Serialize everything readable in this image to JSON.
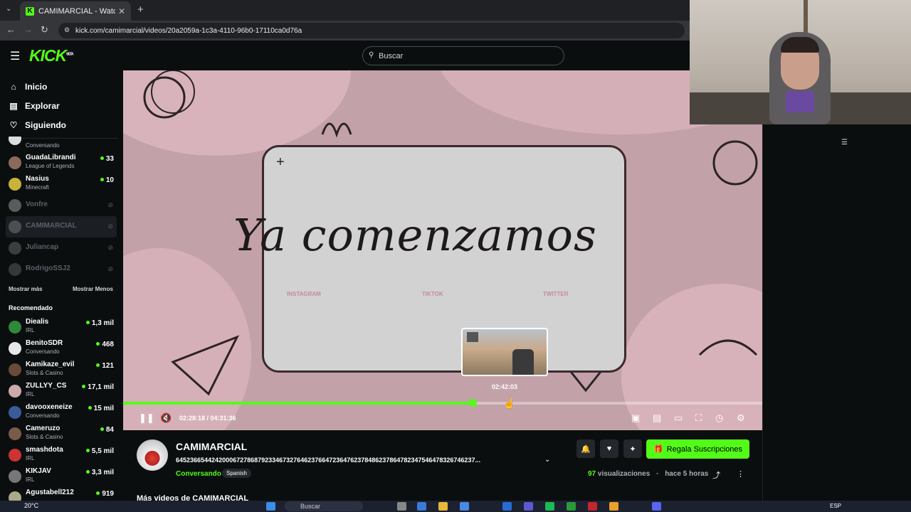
{
  "browser": {
    "tab_title": "CAMIMARCIAL - Watch the VO",
    "url": "kick.com/camimarcial/videos/20a2059a-1c3a-4110-96b0-17110ca0d76a"
  },
  "header": {
    "logo": "KICK",
    "logo_badge": "BETA",
    "search_placeholder": "Buscar"
  },
  "sidebar": {
    "nav": [
      {
        "label": "Inicio",
        "icon": "home-icon"
      },
      {
        "label": "Explorar",
        "icon": "compass-icon"
      },
      {
        "label": "Siguiendo",
        "icon": "heart-icon"
      }
    ],
    "following": [
      {
        "name": "",
        "category": "Conversando",
        "viewers": "",
        "state": "partial"
      },
      {
        "name": "GuadaLibrandi",
        "category": "League of Legends",
        "viewers": "33"
      },
      {
        "name": "Nasius",
        "category": "Minecraft",
        "viewers": "10"
      },
      {
        "name": "Vonfre",
        "category": "",
        "viewers": "",
        "state": "offline"
      },
      {
        "name": "CAMIMARCIAL",
        "category": "",
        "viewers": "",
        "state": "offline-selected"
      },
      {
        "name": "Juliancap",
        "category": "",
        "viewers": "",
        "state": "offline"
      },
      {
        "name": "RodrigoSSJ2",
        "category": "",
        "viewers": "",
        "state": "offline"
      }
    ],
    "show_more": "Mostrar más",
    "show_less": "Mostrar Menos",
    "recommended_title": "Recomendado",
    "recommended": [
      {
        "name": "Diealis",
        "category": "IRL",
        "viewers": "1,3 mil"
      },
      {
        "name": "BenitoSDR",
        "category": "Conversando",
        "viewers": "468"
      },
      {
        "name": "Kamikaze_evil",
        "category": "Slots & Casino",
        "viewers": "121"
      },
      {
        "name": "ZULLYY_CS",
        "category": "IRL",
        "viewers": "17,1 mil"
      },
      {
        "name": "davooxeneize",
        "category": "Conversando",
        "viewers": "15 mil"
      },
      {
        "name": "Cameruzo",
        "category": "Slots & Casino",
        "viewers": "84"
      },
      {
        "name": "smashdota",
        "category": "IRL",
        "viewers": "5,5 mil"
      },
      {
        "name": "KIKJAV",
        "category": "IRL",
        "viewers": "3,3 mil"
      },
      {
        "name": "Agustabell212",
        "category": "",
        "viewers": "919"
      }
    ]
  },
  "video": {
    "overlay_text": "Ya comenzamos",
    "socials": [
      "INSTAGRAM",
      "TIKTOK",
      "TWITTER"
    ],
    "preview_time": "02:42:03",
    "time_display": "02:28:18 / 04:31:36",
    "progress_fraction": 0.547
  },
  "channel": {
    "name": "CAMIMARCIAL",
    "title": "645236654424200067278687923346732764623766472364762378486237864782347546478326746237...",
    "category": "Conversando",
    "language": "Spanish",
    "subscribe_label": "Regala Suscripciones",
    "views_count": "97",
    "views_label": "visualizaciones",
    "time_ago": "hace 5 horas",
    "more_videos": "Más videos de CAMIMARCIAL"
  },
  "taskbar": {
    "weather": "20°C",
    "search": "Buscar",
    "lang": "ESP"
  }
}
